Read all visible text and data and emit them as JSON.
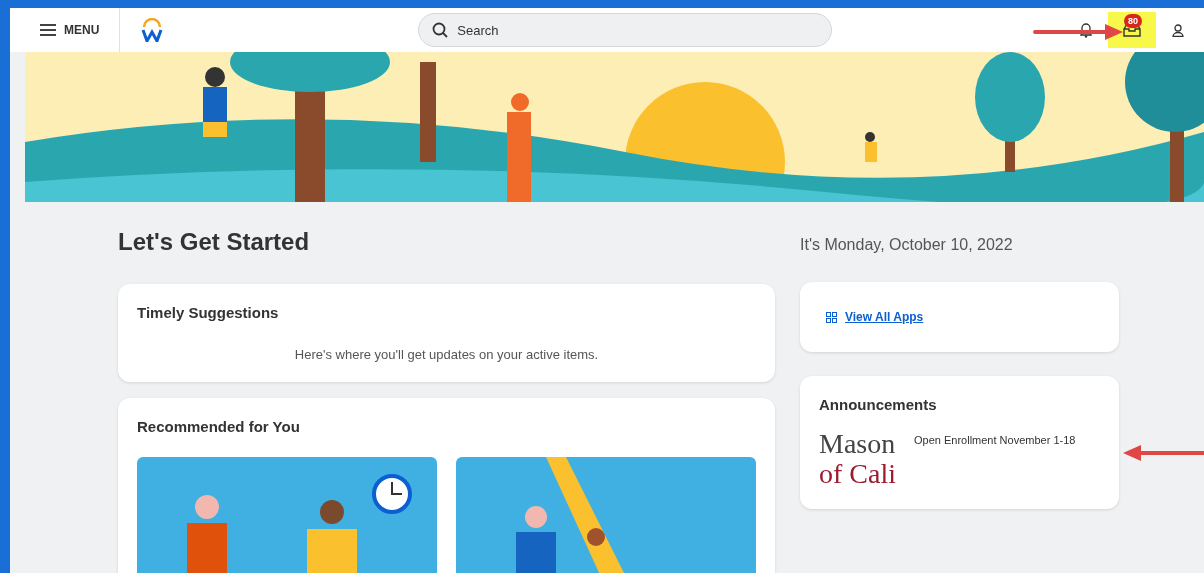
{
  "header": {
    "menu_label": "MENU",
    "search": {
      "placeholder": "Search"
    },
    "inbox": {
      "badge": "80",
      "highlighted": true
    }
  },
  "page": {
    "title": "Let's Get Started",
    "date": "It's Monday, October 10, 2022"
  },
  "timely_suggestions": {
    "title": "Timely Suggestions",
    "message": "Here's where you'll get updates on your active items."
  },
  "recommended": {
    "title": "Recommended for You"
  },
  "apps": {
    "link": "View All Apps"
  },
  "announcements": {
    "title": "Announcements",
    "items": [
      {
        "logo_lines": [
          "Mason",
          "of Cali"
        ],
        "text": "Open Enrollment November 1-18"
      }
    ]
  }
}
